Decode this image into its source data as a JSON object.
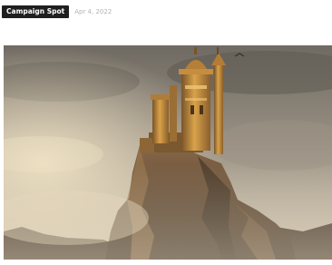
{
  "post_meta": {
    "category_label": "Campaign Spot",
    "date": "Apr 4, 2022"
  },
  "hero_image": {
    "subject": "castle-on-rocky-cliff",
    "colors": {
      "sky_dark": "#6b655d",
      "sky_light": "#c9c0b0",
      "castle_gold": "#c9923f",
      "castle_shadow": "#6b4a26",
      "rock": "#5f4a36",
      "mist": "#d8cbb3"
    }
  }
}
